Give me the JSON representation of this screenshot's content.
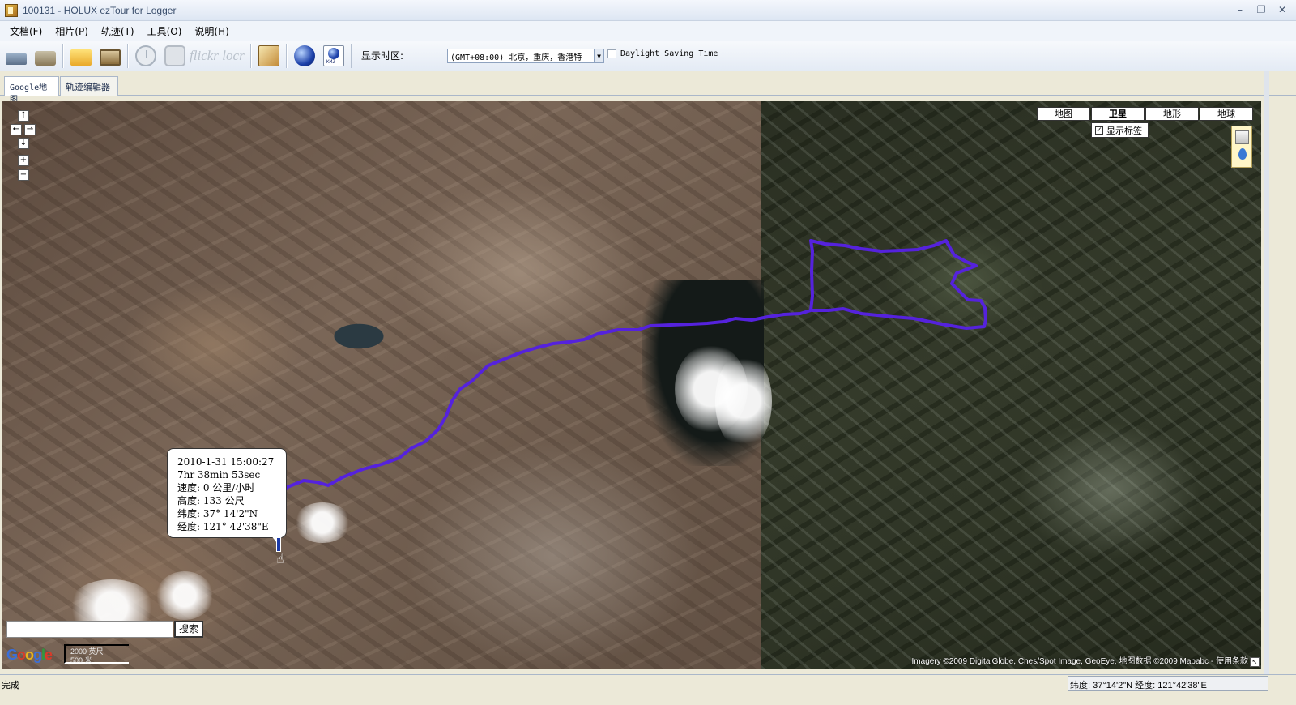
{
  "window": {
    "title": "100131 - HOLUX ezTour for Logger",
    "controls": [
      "–",
      "❐",
      "✕"
    ]
  },
  "menu": {
    "items": [
      "文档(F)",
      "相片(P)",
      "轨迹(T)",
      "工具(O)",
      "说明(H)"
    ]
  },
  "toolbar": {
    "icons": [
      "export-device-icon",
      "import-device-icon",
      "open-folder-icon",
      "photos-icon",
      "clock-icon",
      "camera-icon",
      "flickr-icon",
      "locr-icon",
      "map-icon",
      "google-earth-icon",
      "kmz-icon"
    ],
    "flickr_label": "flickr",
    "locr_label": "locr",
    "kmz_label": "KMZ",
    "timezone_label": "显示时区:",
    "timezone_value": "(GMT+08:00) 北京，重庆，香港特",
    "dst_label": "Daylight Saving Time",
    "dst_checked": false
  },
  "tabs": {
    "items": [
      "Google地图",
      "轨迹编辑器"
    ],
    "active_index": 0
  },
  "map": {
    "nav": {
      "up": "↑",
      "left": "←",
      "right": "→",
      "down": "↓",
      "zoom_in": "+",
      "zoom_out": "−"
    },
    "map_types": [
      "地图",
      "卫星",
      "地形",
      "地球"
    ],
    "selected_type": "卫星",
    "labels_toggle": "显示标签",
    "labels_checked": true,
    "track_color": "#5522dd",
    "popup": {
      "datetime": "2010-1-31 15:00:27",
      "duration": "7hr 38min 53sec",
      "speed": "速度: 0 公里/小时",
      "altitude": "高度: 133 公尺",
      "latitude": "纬度: 37° 14'2\"N",
      "longitude": "经度: 121° 42'38\"E"
    },
    "search_placeholder": "",
    "search_button": "搜索",
    "logo": "Google",
    "scale_top": "2000 英尺",
    "scale_bottom": "500 米",
    "copyright": "Imagery ©2009 DigitalGlobe, Cnes/Spot Image, GeoEye, 地图数据 ©2009 Mapabc - 使用条款"
  },
  "status": {
    "left": "完成",
    "right": "纬度: 37°14'2\"N   经度: 121°42'38\"E"
  }
}
